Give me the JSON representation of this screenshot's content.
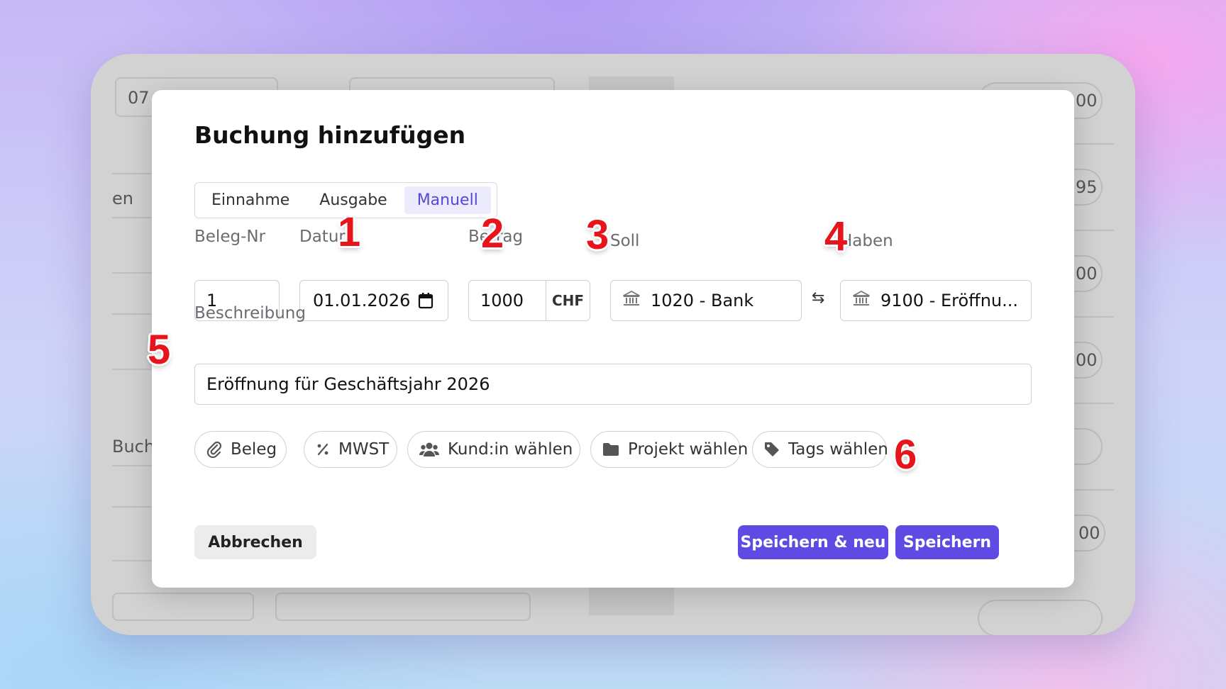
{
  "background_app": {
    "fragments": [
      "07",
      "en",
      "Buchu",
      "00",
      "95",
      "00",
      "00",
      "00"
    ]
  },
  "modal": {
    "title": "Buchung hinzufügen",
    "tabs": [
      {
        "label": "Einnahme",
        "active": false
      },
      {
        "label": "Ausgabe",
        "active": false
      },
      {
        "label": "Manuell",
        "active": true
      }
    ],
    "fields": {
      "beleg_nr": {
        "label": "Beleg-Nr",
        "value": "1"
      },
      "datum": {
        "label": "Datum",
        "value": "01.01.2026"
      },
      "betrag": {
        "label": "Betrag",
        "value": "1000",
        "currency": "CHF"
      },
      "soll": {
        "label": "Soll",
        "value": "1020 - Bank"
      },
      "haben": {
        "label": "Haben",
        "value": "9100 - Eröffnu..."
      },
      "beschreibung": {
        "label": "Beschreibung",
        "value": "Eröffnung für Geschäftsjahr 2026"
      }
    },
    "chips": {
      "beleg": "Beleg",
      "mwst": "MWST",
      "kunde": "Kund:in wählen",
      "projekt": "Projekt wählen",
      "tags": "Tags wählen"
    },
    "buttons": {
      "cancel": "Abbrechen",
      "save_new": "Speichern & neu",
      "save": "Speichern"
    }
  },
  "annotations": [
    "1",
    "2",
    "3",
    "4",
    "5",
    "6"
  ],
  "colors": {
    "primary": "#5f4be4",
    "active_tab_bg": "#ecebfb",
    "annotation_red": "#e8141b"
  },
  "icons": {
    "datum": "calendar-icon",
    "soll": "bank-icon",
    "haben": "bank-icon",
    "swap": "swap-arrows-icon",
    "beleg": "paperclip-icon",
    "mwst": "percent-icon",
    "kunde": "users-icon",
    "projekt": "folder-icon",
    "tags": "tag-icon"
  }
}
